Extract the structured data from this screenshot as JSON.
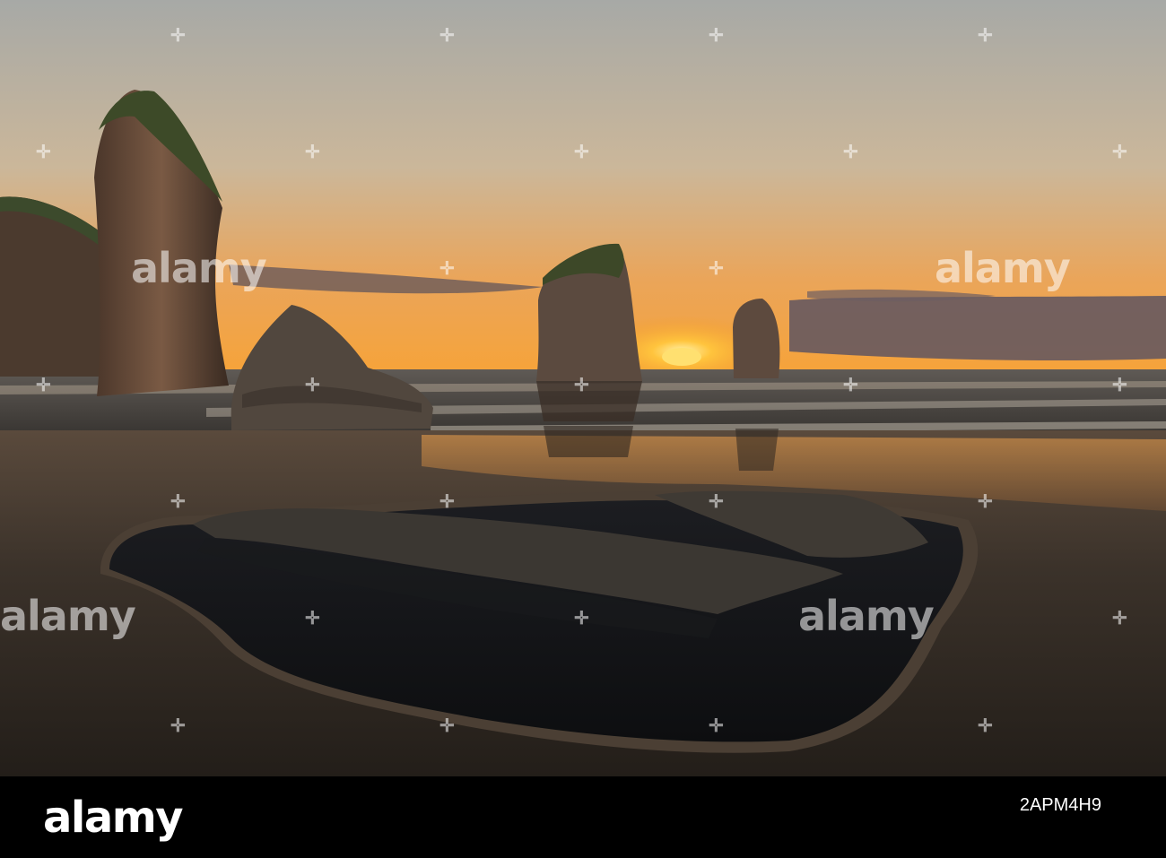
{
  "watermark": {
    "logo_text": "alamy"
  },
  "footer": {
    "logo_text": "alamy",
    "image_id": "2APM4H9",
    "background_color": "#000000"
  },
  "scene": {
    "sky_top_color": "#a9aaa6",
    "sky_horizon_color": "#f2a13a",
    "sun_color": "#ffd24d",
    "sand_color": "#3a3128",
    "pool_color": "#141518"
  }
}
